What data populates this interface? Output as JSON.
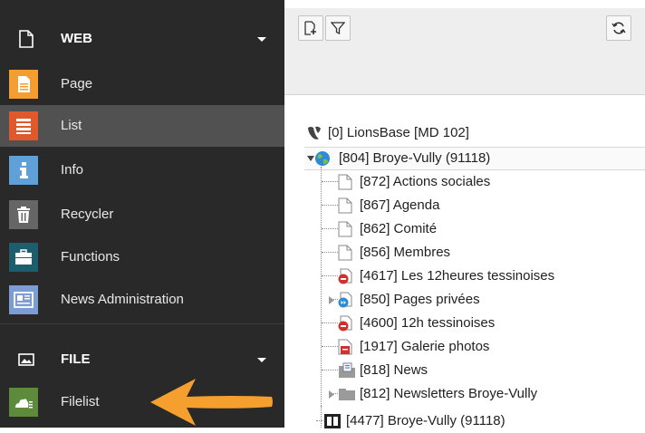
{
  "sidebar": {
    "groups": [
      {
        "label": "WEB",
        "icon": "document-icon"
      },
      {
        "label": "FILE",
        "icon": "image-icon"
      }
    ],
    "modules": [
      {
        "label": "Page",
        "icon": "page-module-icon",
        "color": "#f49e31",
        "active": false
      },
      {
        "label": "List",
        "icon": "list-module-icon",
        "color": "#e0592c",
        "active": true
      },
      {
        "label": "Info",
        "icon": "info-module-icon",
        "color": "#5fa0d8",
        "active": false
      },
      {
        "label": "Recycler",
        "icon": "trash-module-icon",
        "color": "#666666",
        "active": false
      },
      {
        "label": "Functions",
        "icon": "toolbox-module-icon",
        "color": "#1d5e6e",
        "active": false
      },
      {
        "label": "News Administration",
        "icon": "news-module-icon",
        "color": "#7c9cd4",
        "active": false
      },
      {
        "label": "Filelist",
        "icon": "cloud-module-icon",
        "color": "#5e8a3c",
        "active": false
      }
    ]
  },
  "toolbar": {
    "new_page": "new-page-icon",
    "filter": "filter-icon",
    "refresh": "refresh-icon"
  },
  "tree": {
    "root": "[0] LionsBase [MD 102]",
    "site": "[804] Broye-Vully (91118)",
    "children": [
      "[872] Actions sociales",
      "[867] Agenda",
      "[862] Comité",
      "[856] Membres",
      "[4617] Les 12heures tessinoises",
      "[850] Pages privées",
      "[4600] 12h tessinoises",
      "[1917] Galerie photos",
      "[818] News",
      "[812] Newsletters Broye-Vully"
    ],
    "next_site": "[4477] Broye-Vully (91118)"
  },
  "colors": {
    "sidebar_bg": "#292929",
    "active_bg": "#515151",
    "arrow": "#f5a02e",
    "toolbar_bg": "#eeeeee"
  }
}
